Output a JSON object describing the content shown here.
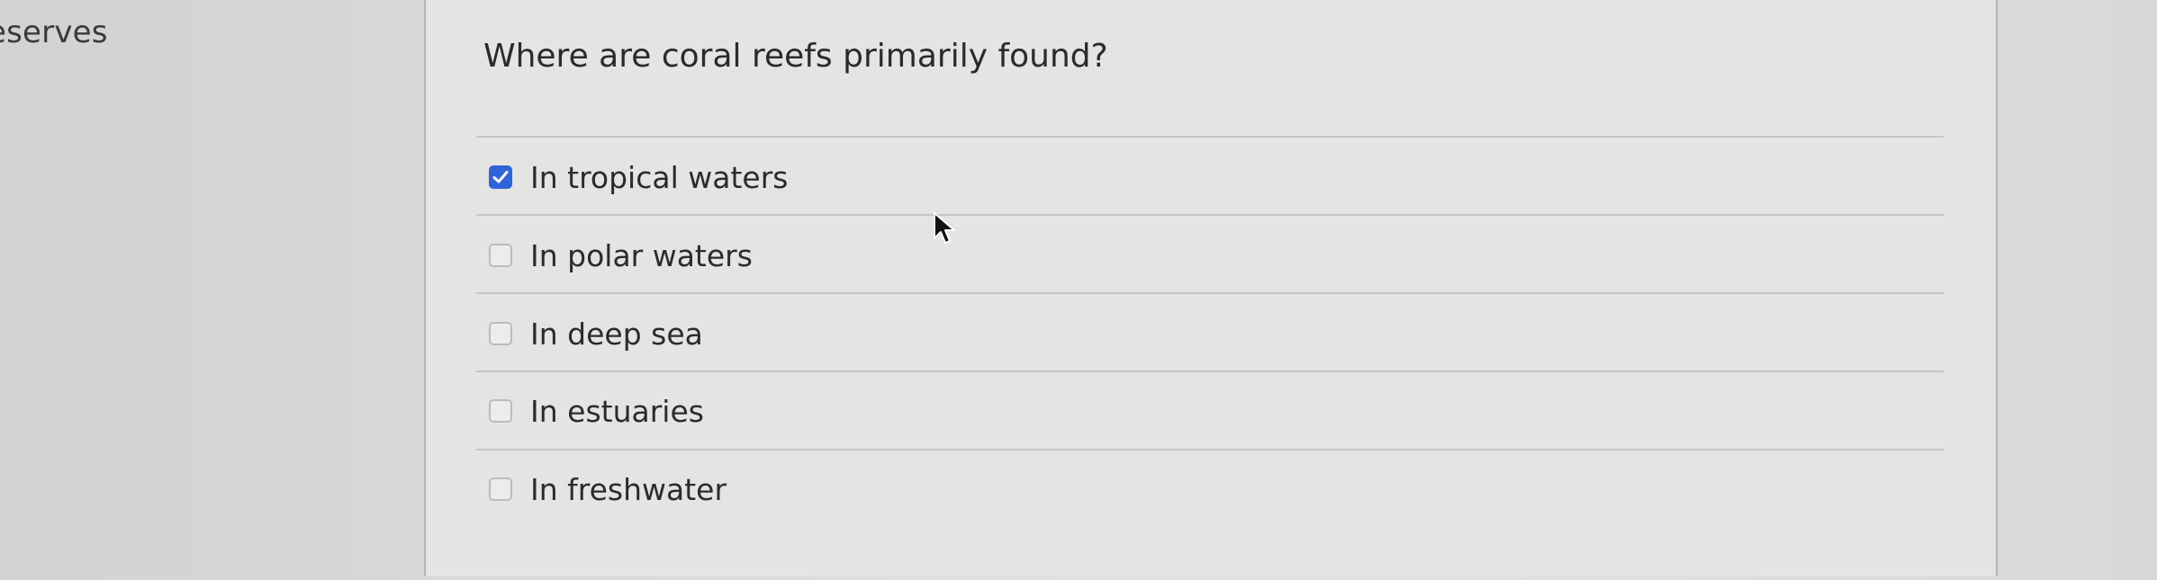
{
  "sidebar": {
    "heading_fragment": "eserves"
  },
  "question": {
    "text": "Where are coral reefs primarily found?",
    "answers": [
      {
        "label": "In tropical waters",
        "checked": true
      },
      {
        "label": "In polar waters",
        "checked": false
      },
      {
        "label": "In deep sea",
        "checked": false
      },
      {
        "label": "In estuaries",
        "checked": false
      },
      {
        "label": "In freshwater",
        "checked": false
      }
    ]
  },
  "colors": {
    "checkbox_checked": "#2f63d8",
    "panel_background": "#e4e4e2"
  },
  "icons": {
    "checkmark": "checkmark-icon",
    "cursor": "mouse-pointer-icon"
  }
}
